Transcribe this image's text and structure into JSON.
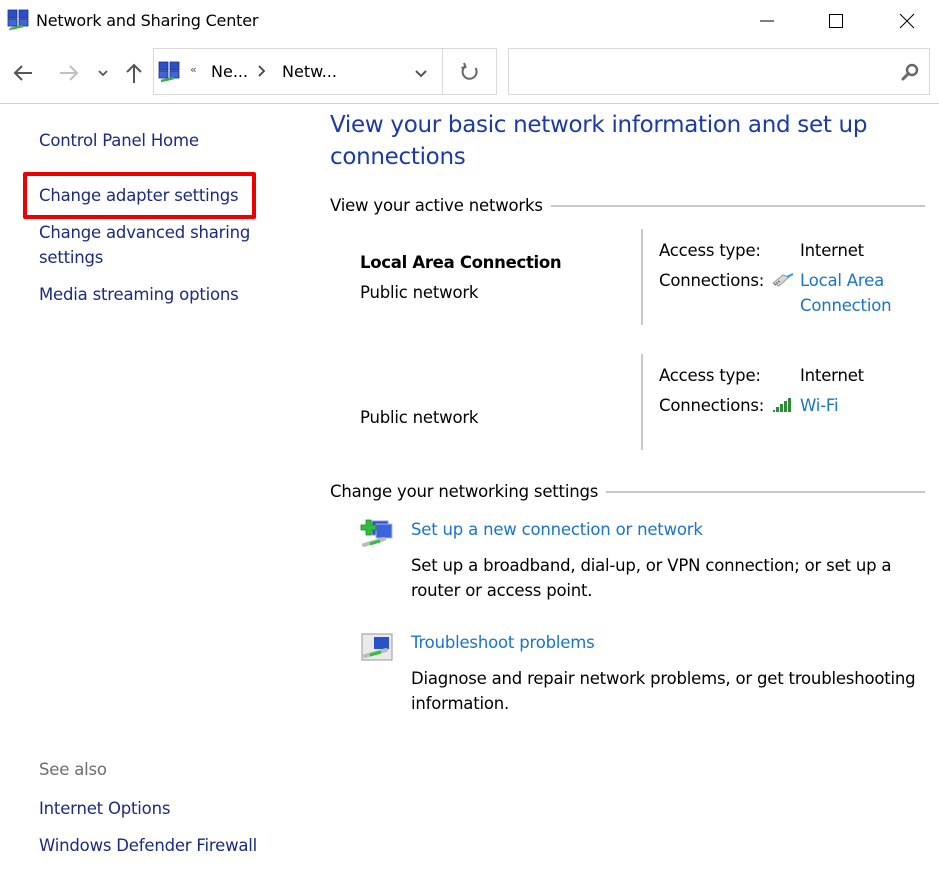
{
  "window": {
    "title": "Network and Sharing Center",
    "app_icon": "network-center-icon",
    "controls": {
      "minimize": "minimize-icon",
      "maximize": "maximize-icon",
      "close": "close-icon"
    }
  },
  "navbar": {
    "back_icon": "arrow-left-icon",
    "forward_icon": "arrow-right-icon",
    "recent_icon": "chevron-down-icon",
    "up_icon": "arrow-up-icon",
    "address": {
      "overflow": "«",
      "crumbs": [
        "Ne...",
        "Netw..."
      ],
      "separator_icon": "chevron-right-icon",
      "dropdown_icon": "chevron-down-icon"
    },
    "refresh_icon": "refresh-icon",
    "search": {
      "value": "",
      "placeholder": "",
      "icon": "search-icon"
    }
  },
  "sidebar": {
    "links": [
      {
        "label": "Control Panel Home"
      },
      {
        "label": "Change adapter settings",
        "highlighted": true
      },
      {
        "label": "Change advanced sharing settings"
      },
      {
        "label": "Media streaming options"
      }
    ],
    "see_also_label": "See also",
    "see_also": [
      {
        "label": "Internet Options"
      },
      {
        "label": "Windows Defender Firewall"
      }
    ],
    "highlight_color": "#ee0000"
  },
  "main": {
    "title": "View your basic network information and set up connections",
    "active_networks_label": "View your active networks",
    "networks": [
      {
        "name": "Local Area Connection",
        "type": "Public network",
        "access_type_label": "Access type:",
        "access_type": "Internet",
        "connections_label": "Connections:",
        "connection_icon": "ethernet-icon",
        "connection": "Local Area Connection"
      },
      {
        "name": "",
        "type": "Public network",
        "access_type_label": "Access type:",
        "access_type": "Internet",
        "connections_label": "Connections:",
        "connection_icon": "wifi-signal-icon",
        "connection": "Wi-Fi"
      }
    ],
    "change_settings_label": "Change your networking settings",
    "tasks": [
      {
        "icon": "new-connection-icon",
        "link": "Set up a new connection or network",
        "description": "Set up a broadband, dial-up, or VPN connection; or set up a router or access point."
      },
      {
        "icon": "troubleshoot-icon",
        "link": "Troubleshoot problems",
        "description": "Diagnose and repair network problems, or get troubleshooting information."
      }
    ]
  },
  "colors": {
    "sidebar_link": "#1a2b80",
    "title_blue": "#1a3aa8",
    "link_blue": "#1a74c8",
    "muted": "#6d6d6d"
  }
}
